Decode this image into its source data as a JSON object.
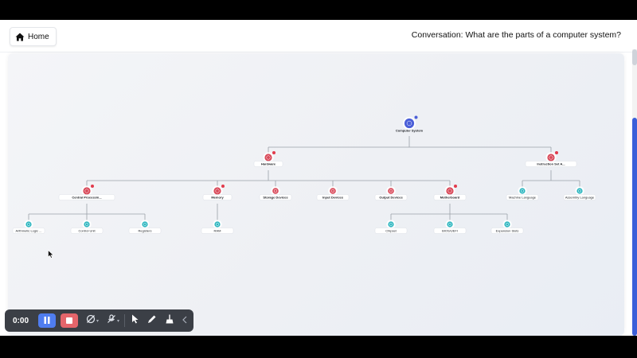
{
  "header": {
    "home_label": "Home",
    "conversation_title": "Conversation: What are the parts of a computer system?"
  },
  "toolbar": {
    "time": "0:00",
    "icons": [
      "pause-icon",
      "stop-icon",
      "camera-off-icon",
      "mic-off-icon",
      "pointer-icon",
      "pen-icon",
      "broom-icon",
      "chevron-left-icon"
    ]
  },
  "colors": {
    "root": "#4b5fd8",
    "expanded": "#d94a5a",
    "leaf": "#2bb5bf",
    "badge": "#e23b4c",
    "toolbar_bg": "#3b3f46",
    "pause": "#4f7df0",
    "stop": "#e4656b"
  },
  "tree": {
    "label": "Computer System",
    "state": "root",
    "children": [
      {
        "label": "Hardware",
        "state": "expanded",
        "children": [
          {
            "label": "Central Processin...",
            "state": "expanded",
            "children": [
              {
                "label": "Arithmetic Logic ...",
                "state": "leaf"
              },
              {
                "label": "Control Unit",
                "state": "leaf"
              },
              {
                "label": "Registers",
                "state": "leaf"
              }
            ]
          },
          {
            "label": "Memory",
            "state": "expanded",
            "children": [
              {
                "label": "RAM",
                "state": "leaf"
              }
            ]
          },
          {
            "label": "Storage Devices",
            "state": "collapsed"
          },
          {
            "label": "Input Devices",
            "state": "collapsed"
          },
          {
            "label": "Output Devices",
            "state": "collapsed"
          },
          {
            "label": "Motherboard",
            "state": "expanded",
            "children": [
              {
                "label": "Chipset",
                "state": "leaf"
              },
              {
                "label": "BIOS/UEFI",
                "state": "leaf"
              },
              {
                "label": "Expansion Slots",
                "state": "leaf"
              }
            ]
          }
        ]
      },
      {
        "label": "Instruction Set A...",
        "state": "expanded",
        "children": [
          {
            "label": "Machine Language",
            "state": "leaf"
          },
          {
            "label": "Assembly Language",
            "state": "leaf"
          }
        ]
      }
    ]
  }
}
